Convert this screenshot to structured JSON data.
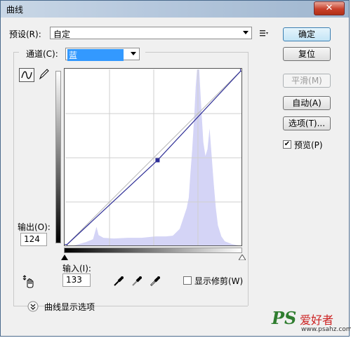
{
  "window": {
    "title": "曲线",
    "close_glyph": "✕"
  },
  "preset": {
    "label": "预设(R):",
    "value": "自定"
  },
  "channel": {
    "label": "通道(C):",
    "value": "蓝"
  },
  "buttons": {
    "ok": "确定",
    "reset": "复位",
    "smooth": "平滑(M)",
    "auto": "自动(A)",
    "options": "选项(T)..."
  },
  "preview": {
    "label": "预览(P)",
    "checked": true
  },
  "output": {
    "label": "输出(O):",
    "value": "124"
  },
  "input": {
    "label": "输入(I):",
    "value": "133"
  },
  "show_clipping": {
    "label": "显示修剪(W)",
    "checked": false
  },
  "curve_options": {
    "label": "曲线显示选项"
  },
  "icons": {
    "preset_menu": "preset-menu-icon",
    "curve_tool": "curve-point-icon",
    "pencil_tool": "pencil-icon",
    "adjust_tool": "on-image-adjust-icon",
    "black_eyedropper": "black-eyedropper-icon",
    "gray_eyedropper": "gray-eyedropper-icon",
    "white_eyedropper": "white-eyedropper-icon",
    "expand": "expand-icon"
  },
  "colors": {
    "histogram": "#d4d4f6",
    "curve": "#2e2e96",
    "highlight_select": "#3399ff"
  },
  "chart_data": {
    "type": "area",
    "x_range": [
      0,
      255
    ],
    "y_range": [
      0,
      255
    ],
    "curve_points": [
      [
        0,
        0
      ],
      [
        133,
        124
      ],
      [
        255,
        255
      ]
    ],
    "selected_point": [
      133,
      124
    ],
    "histogram": [
      [
        0,
        0
      ],
      [
        12,
        1
      ],
      [
        20,
        3
      ],
      [
        30,
        6
      ],
      [
        40,
        10
      ],
      [
        45,
        28
      ],
      [
        48,
        16
      ],
      [
        55,
        12
      ],
      [
        70,
        11
      ],
      [
        90,
        12
      ],
      [
        110,
        12
      ],
      [
        130,
        14
      ],
      [
        145,
        14
      ],
      [
        155,
        15
      ],
      [
        160,
        20
      ],
      [
        165,
        25
      ],
      [
        170,
        40
      ],
      [
        175,
        55
      ],
      [
        178,
        70
      ],
      [
        180,
        100
      ],
      [
        183,
        140
      ],
      [
        186,
        190
      ],
      [
        188,
        230
      ],
      [
        190,
        255
      ],
      [
        193,
        255
      ],
      [
        196,
        200
      ],
      [
        199,
        150
      ],
      [
        202,
        130
      ],
      [
        205,
        140
      ],
      [
        208,
        170
      ],
      [
        211,
        130
      ],
      [
        214,
        90
      ],
      [
        217,
        55
      ],
      [
        220,
        30
      ],
      [
        225,
        14
      ],
      [
        230,
        7
      ],
      [
        240,
        3
      ],
      [
        255,
        0
      ]
    ]
  },
  "watermark": {
    "ps": "PS",
    "site_cn": "爱好者",
    "url": "www.psahz.com"
  }
}
